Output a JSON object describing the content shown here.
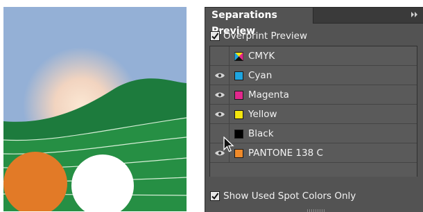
{
  "panel": {
    "title": "Separations Preview",
    "menu_icon": "panel-menu-icon",
    "overprint_label": "Overprint Preview",
    "overprint_checked": true,
    "show_spot_label": "Show Used Spot Colors Only",
    "show_spot_checked": true
  },
  "separations": [
    {
      "name": "CMYK",
      "color": "cmyk",
      "visible": false
    },
    {
      "name": "Cyan",
      "color": "#1ea5e0",
      "visible": true
    },
    {
      "name": "Magenta",
      "color": "#e1288c",
      "visible": true
    },
    {
      "name": "Yellow",
      "color": "#f4e60e",
      "visible": true
    },
    {
      "name": "Black",
      "color": "#000000",
      "visible": false
    },
    {
      "name": "PANTONE 138 C",
      "color": "#ef8a2a",
      "visible": true
    }
  ],
  "colors": {
    "sky": "#94b0d6",
    "sun_glow": "#f6dcc4",
    "hill_back": "#1c7a3c",
    "hill_front": "#2a9347",
    "orange_circle": "#e27a27",
    "white_circle": "#ffffff",
    "panel_bg": "#535353"
  }
}
